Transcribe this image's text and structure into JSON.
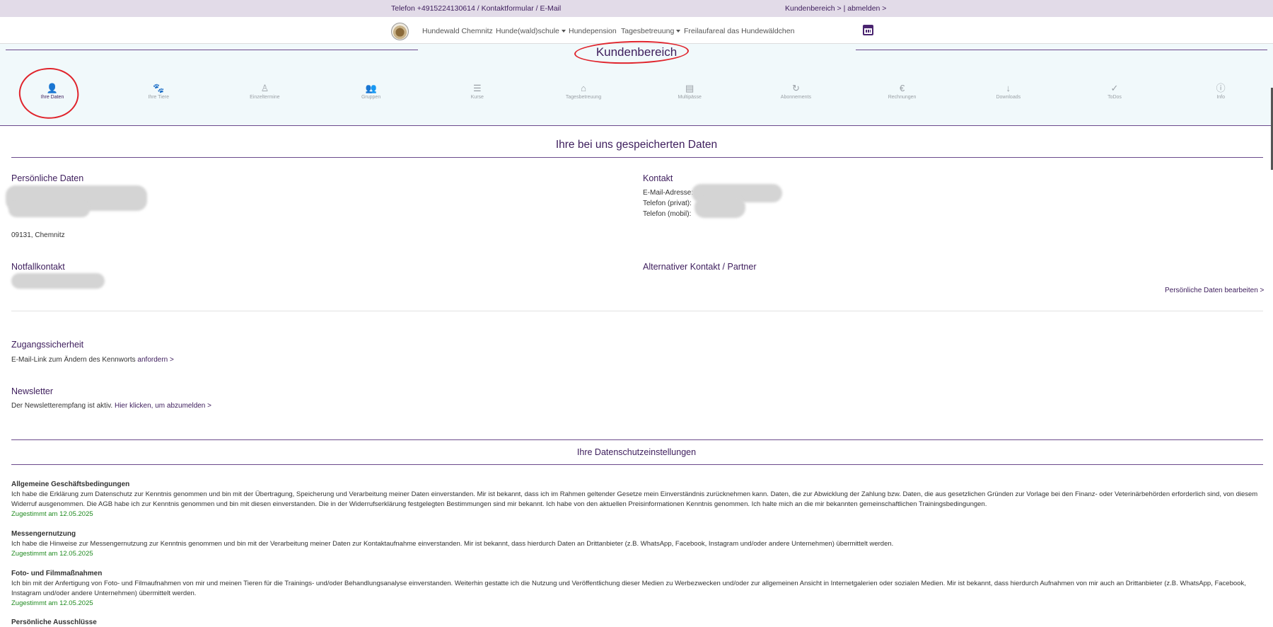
{
  "topbar": {
    "contact": "Telefon +4915224130614 / Kontaktformular / E-Mail",
    "account": "Kundenbereich > | abmelden >"
  },
  "nav": {
    "items": [
      {
        "label": "Hundewald Chemnitz"
      },
      {
        "label": "Hunde(wald)schule",
        "dropdown": true
      },
      {
        "label": "Hundepension"
      },
      {
        "label": "Tagesbetreuung",
        "dropdown": true
      },
      {
        "label": "Freilaufareal das Hundewäldchen"
      }
    ],
    "calendar_icon": "calendar-icon"
  },
  "header": {
    "title": "Kundenbereich",
    "tabs": [
      {
        "label": "Ihre Daten",
        "icon": "person-icon",
        "glyph": "👤",
        "active": true
      },
      {
        "label": "Ihre Tiere",
        "icon": "paw-icon",
        "glyph": "🐾"
      },
      {
        "label": "Einzeltermine",
        "icon": "person-outline-icon",
        "glyph": "♙"
      },
      {
        "label": "Gruppen",
        "icon": "group-icon",
        "glyph": "👥"
      },
      {
        "label": "Kurse",
        "icon": "list-icon",
        "glyph": "☰"
      },
      {
        "label": "Tagesbetreuung",
        "icon": "home-icon",
        "glyph": "⌂"
      },
      {
        "label": "Multipässe",
        "icon": "card-icon",
        "glyph": "▤"
      },
      {
        "label": "Abonnements",
        "icon": "refresh-icon",
        "glyph": "↻"
      },
      {
        "label": "Rechnungen",
        "icon": "euro-icon",
        "glyph": "€"
      },
      {
        "label": "Downloads",
        "icon": "download-icon",
        "glyph": "↓"
      },
      {
        "label": "ToDos",
        "icon": "check-icon",
        "glyph": "✓"
      },
      {
        "label": "Info",
        "icon": "info-icon",
        "glyph": "ⓘ"
      }
    ],
    "accent": "#3d1d5c",
    "annotation_color": "#e0242c"
  },
  "main": {
    "title": "Ihre bei uns gespeicherten Daten",
    "personal": {
      "heading": "Persönliche Daten",
      "city": "09131, Chemnitz"
    },
    "contact": {
      "heading": "Kontakt",
      "email_label": "E-Mail-Adresse:",
      "phone_private_label": "Telefon (privat):",
      "phone_mobile_label": "Telefon (mobil):"
    },
    "emergency": {
      "heading": "Notfallkontakt"
    },
    "alternative": {
      "heading": "Alternativer Kontakt / Partner"
    },
    "edit_link": "Persönliche Daten bearbeiten >",
    "security": {
      "heading": "Zugangssicherheit",
      "text": "E-Mail-Link zum Ändern des Kennworts",
      "link": "anfordern >"
    },
    "newsletter": {
      "heading": "Newsletter",
      "text": "Der Newsletterempfang ist aktiv.",
      "link": "Hier klicken, um abzumelden >"
    }
  },
  "privacy": {
    "title": "Ihre Datenschutzeinstellungen",
    "items": [
      {
        "heading": "Allgemeine Geschäftsbedingungen",
        "text": "Ich habe die Erklärung zum Datenschutz zur Kenntnis genommen und bin mit der Übertragung, Speicherung und Verarbeitung meiner Daten einverstanden. Mir ist bekannt, dass ich im Rahmen geltender Gesetze mein Einverständnis zurücknehmen kann. Daten, die zur Abwicklung der Zahlung bzw. Daten, die aus gesetzlichen Gründen zur Vorlage bei den Finanz- oder Veterinärbehörden erforderlich sind, von diesem Widerruf ausgenommen. Die AGB habe ich zur Kenntnis genommen und bin mit diesen einverstanden. Die in der Widerrufserklärung festgelegten Bestimmungen sind mir bekannt. Ich habe von den aktuellen Preisinformationen Kenntnis genommen. Ich halte mich an die mir bekannten gemeinschaftlichen Trainingsbedingungen.",
        "status": "Zugestimmt am 12.05.2025"
      },
      {
        "heading": "Messengernutzung",
        "text": "Ich habe die Hinweise zur Messengernutzung zur Kenntnis genommen und bin mit der Verarbeitung meiner Daten zur Kontaktaufnahme einverstanden. Mir ist bekannt, dass hierdurch Daten an Drittanbieter (z.B. WhatsApp, Facebook, Instagram und/oder andere Unternehmen) übermittelt werden.",
        "status": "Zugestimmt am 12.05.2025"
      },
      {
        "heading": "Foto- und Filmmaßnahmen",
        "text": "Ich bin mit der Anfertigung von Foto- und Filmaufnahmen von mir und meinen Tieren für die Trainings- und/oder Behandlungsanalyse einverstanden. Weiterhin gestatte ich die Nutzung und Veröffentlichung dieser Medien zu Werbezwecken und/oder zur allgemeinen Ansicht in Internetgalerien oder sozialen Medien. Mir ist bekannt, dass hierdurch Aufnahmen von mir auch an Drittanbieter (z.B. WhatsApp, Facebook, Instagram und/oder andere Unternehmen) übermittelt werden.",
        "status": "Zugestimmt am 12.05.2025"
      },
      {
        "heading": "Persönliche Ausschlüsse",
        "text": "",
        "status": ""
      }
    ],
    "status_color": "#1f8a1f"
  }
}
